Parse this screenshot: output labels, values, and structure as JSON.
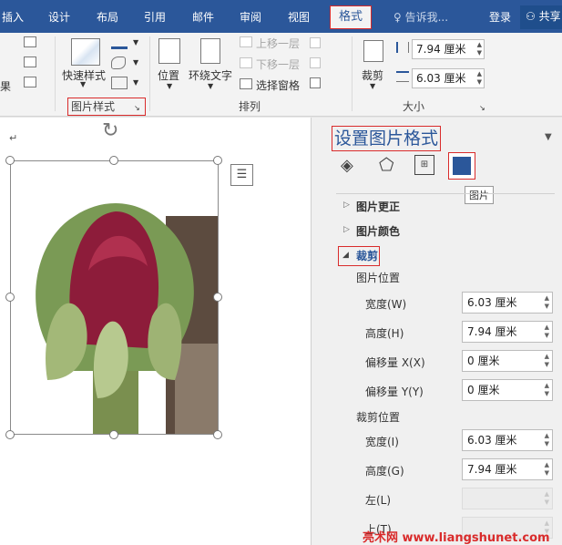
{
  "tabs": {
    "insert": "插入",
    "design": "设计",
    "layout": "布局",
    "references": "引用",
    "mailings": "邮件",
    "review": "审阅",
    "view": "视图",
    "format": "格式"
  },
  "tellme": "告诉我...",
  "login": "登录",
  "share": "共享",
  "ribbon": {
    "partial_label": "果",
    "quick_styles": "快速样式",
    "group_picture_styles": "图片样式",
    "position": "位置",
    "wrap_text": "环绕文字",
    "bring_forward": "上移一层",
    "send_backward": "下移一层",
    "selection_pane": "选择窗格",
    "group_arrange": "排列",
    "crop": "裁剪",
    "height_value": "7.94 厘米",
    "width_value": "6.03 厘米",
    "group_size": "大小"
  },
  "pane": {
    "title": "设置图片格式",
    "tooltip": "图片",
    "section_corrections": "图片更正",
    "section_color": "图片颜色",
    "section_crop": "裁剪",
    "picture_position": "图片位置",
    "width_label": "宽度(W)",
    "width_value": "6.03 厘米",
    "height_label": "高度(H)",
    "height_value": "7.94 厘米",
    "offset_x_label": "偏移量 X(X)",
    "offset_x_value": "0 厘米",
    "offset_y_label": "偏移量 Y(Y)",
    "offset_y_value": "0 厘米",
    "crop_position": "裁剪位置",
    "crop_width_label": "宽度(I)",
    "crop_width_value": "6.03 厘米",
    "crop_height_label": "高度(G)",
    "crop_height_value": "7.94 厘米",
    "left_label": "左(L)",
    "top_label": "上(T)"
  },
  "watermark": "亮术网 www.liangshunet.com",
  "colors": {
    "ribbon_blue": "#2b579a",
    "highlight_red": "#d92b2b"
  },
  "icons": [
    "fill-icon",
    "effects-icon",
    "layout-size-icon",
    "picture-icon",
    "rotate-handle-icon",
    "layout-options-icon"
  ]
}
